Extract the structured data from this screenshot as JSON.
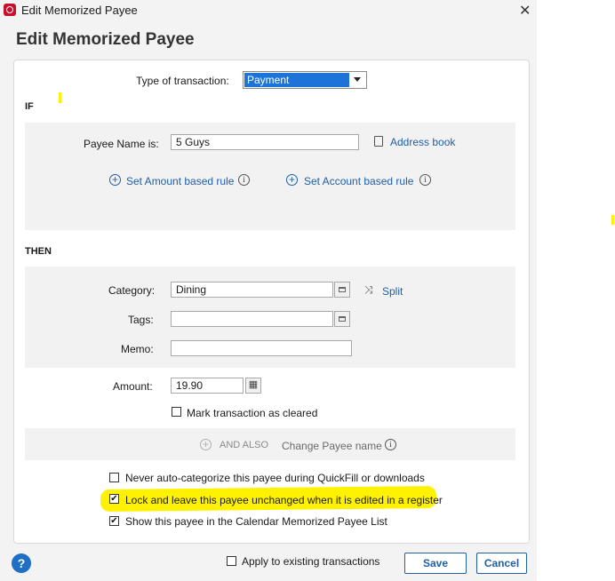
{
  "window": {
    "title": "Edit Memorized Payee",
    "close_glyph": "✕"
  },
  "heading": "Edit Memorized Payee",
  "transaction_type": {
    "label": "Type of transaction:",
    "value": "Payment"
  },
  "if_section": {
    "header": "IF",
    "payee_label": "Payee Name is:",
    "payee_value": "5 Guys",
    "address_book": "Address book",
    "amount_rule": "Set Amount based rule",
    "account_rule": "Set Account based rule"
  },
  "then_section": {
    "header": "THEN",
    "category_label": "Category:",
    "category_value": "Dining",
    "split_label": "Split",
    "tags_label": "Tags:",
    "tags_value": "",
    "memo_label": "Memo:",
    "memo_value": "",
    "amount_label": "Amount:",
    "amount_value": "19.90",
    "mark_cleared": {
      "label": "Mark transaction as cleared",
      "checked": false
    },
    "and_also": "AND ALSO",
    "change_payee_name": "Change Payee name"
  },
  "options": [
    {
      "label": "Never auto-categorize this payee during QuickFill or downloads",
      "checked": false
    },
    {
      "label": "Lock and leave this payee unchanged when it is edited in a register",
      "checked": true
    },
    {
      "label": "Show this payee in the Calendar Memorized Payee List",
      "checked": true
    }
  ],
  "footer": {
    "help": "?",
    "apply_existing": {
      "label": "Apply to existing transactions",
      "checked": false
    },
    "save": "Save",
    "cancel": "Cancel"
  },
  "colors": {
    "accent": "#1f5fa8",
    "highlight": "#fff200",
    "brand": "#c8102e"
  }
}
